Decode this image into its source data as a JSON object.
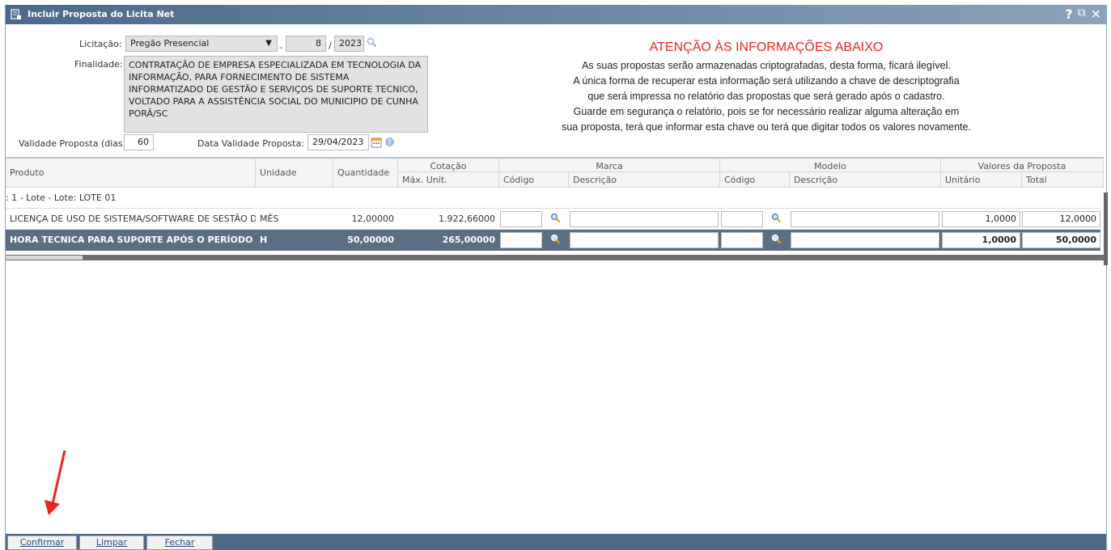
{
  "window": {
    "title": "Incluir Proposta do Licita Net",
    "buttons": [
      "?",
      "⧉",
      "✕"
    ]
  },
  "form": {
    "licitacao_label": "Licitação:",
    "licitacao_tipo": "Pregão Presencial",
    "licitacao_sep1": "-",
    "licitacao_numero": "8",
    "licitacao_sep2": "/",
    "licitacao_ano": "2023",
    "finalidade_label": "Finalidade:",
    "finalidade_text": "CONTRATAÇÃO DE EMPRESA ESPECIALIZADA EM TECNOLOGIA DA INFORMAÇÃO, PARA FORNECIMENTO DE SISTEMA INFORMATIZADO DE GESTÃO E SERVIÇOS DE SUPORTE TECNICO, VOLTADO PARA A ASSISTÊNCIA SOCIAL DO MUNICIPIO DE CUNHA PORÃ/SC",
    "validade_label": "Validade Proposta (dias):",
    "validade_value": "60",
    "data_validade_label": "Data Validade Proposta:",
    "data_validade_value": "29/04/2023"
  },
  "warning": {
    "title": "ATENÇÃO ÀS INFORMAÇÕES ABAIXO",
    "lines": [
      "As suas propostas serão armazenadas criptografadas, desta forma, ficará ilegível.",
      "A única forma de recuperar esta informação será utilizando a chave de descriptografia",
      "que será impressa no relatório das propostas que será gerado após o cadastro.",
      "Guarde em segurança o relatório, pois se for necessário realizar alguma alteração em",
      "sua proposta, terá que informar esta chave ou terá que digitar todos os valores novamente."
    ],
    "color": "#e52521"
  },
  "grid": {
    "headers": {
      "produto": "Produto",
      "unidade": "Unidade",
      "quantidade": "Quantidade",
      "cotacao": "Cotação",
      "max_unit": "Máx. Unit.",
      "marca": "Marca",
      "marca_codigo": "Código",
      "marca_descricao": "Descrição",
      "modelo": "Modelo",
      "modelo_codigo": "Código",
      "modelo_descricao": "Descrição",
      "valores": "Valores da Proposta",
      "unitario": "Unitário",
      "total": "Total"
    },
    "group_label": ": 1 - Lote - Lote: LOTE 01",
    "rows": [
      {
        "produto": "LICENÇA DE USO DE SISTEMA/SOFTWARE DE SESTÃO D...",
        "unidade": "MÊS",
        "quantidade": "12,00000",
        "max_unit": "1.922,66000",
        "unitario": "1,0000",
        "total": "12,0000"
      },
      {
        "produto": "HORA TECNICA PARA SUPORTE APÓS O PERÍODO DE IM...",
        "unidade": "H",
        "quantidade": "50,00000",
        "max_unit": "265,00000",
        "unitario": "1,0000",
        "total": "50,0000"
      }
    ],
    "selected_row_color": "#5b6f84"
  },
  "footer": {
    "confirmar": "Confirmar",
    "limpar": "Limpar",
    "fechar": "Fechar"
  }
}
